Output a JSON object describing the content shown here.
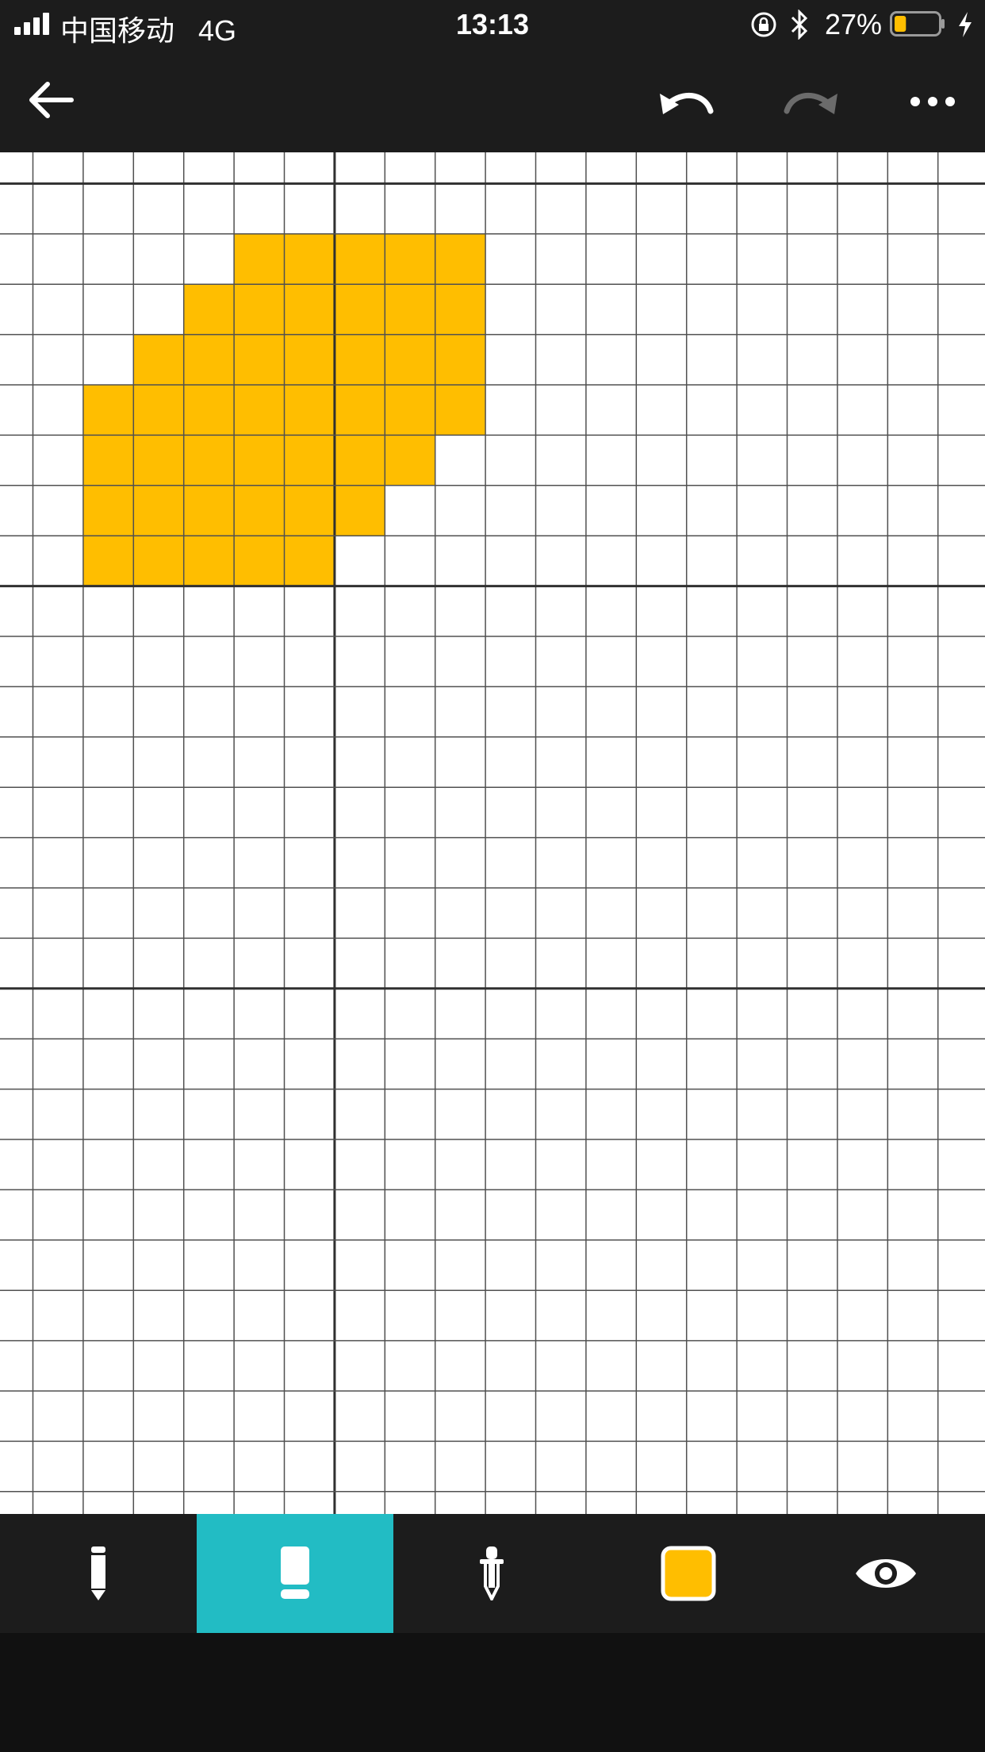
{
  "status_bar": {
    "carrier": "中国移动   4G",
    "time": "13:13",
    "battery": "27%",
    "battery_level": 0.27
  },
  "toolbar": {
    "back_icon": "arrow-left-icon",
    "undo_icon": "undo-icon",
    "redo_icon": "redo-icon",
    "more_icon": "more-horizontal-icon",
    "redo_enabled": false
  },
  "canvas": {
    "fill_color": "#ffbe00",
    "grid_color": "#505050",
    "major_line_color": "#303030",
    "columns": 14,
    "rows": 20,
    "filled_cells": [
      [
        2,
        5
      ],
      [
        2,
        6
      ],
      [
        2,
        7
      ],
      [
        2,
        8
      ],
      [
        2,
        9
      ],
      [
        3,
        4
      ],
      [
        3,
        5
      ],
      [
        3,
        6
      ],
      [
        3,
        7
      ],
      [
        3,
        8
      ],
      [
        3,
        9
      ],
      [
        4,
        3
      ],
      [
        4,
        4
      ],
      [
        4,
        5
      ],
      [
        4,
        6
      ],
      [
        4,
        7
      ],
      [
        4,
        8
      ],
      [
        4,
        9
      ],
      [
        5,
        2
      ],
      [
        5,
        3
      ],
      [
        5,
        4
      ],
      [
        5,
        5
      ],
      [
        5,
        6
      ],
      [
        5,
        7
      ],
      [
        5,
        8
      ],
      [
        5,
        9
      ],
      [
        6,
        2
      ],
      [
        6,
        3
      ],
      [
        6,
        4
      ],
      [
        6,
        5
      ],
      [
        6,
        6
      ],
      [
        6,
        7
      ],
      [
        6,
        8
      ],
      [
        7,
        2
      ],
      [
        7,
        3
      ],
      [
        7,
        4
      ],
      [
        7,
        5
      ],
      [
        7,
        6
      ],
      [
        7,
        7
      ],
      [
        8,
        2
      ],
      [
        8,
        3
      ],
      [
        8,
        4
      ],
      [
        8,
        5
      ],
      [
        8,
        6
      ]
    ]
  },
  "tools": [
    {
      "id": "pencil",
      "icon": "pencil-icon",
      "active": false
    },
    {
      "id": "eraser",
      "icon": "eraser-icon",
      "active": true
    },
    {
      "id": "eyedropper",
      "icon": "eyedropper-icon",
      "active": false
    },
    {
      "id": "color",
      "icon": "color-swatch-icon",
      "active": false,
      "color": "#ffbe00"
    },
    {
      "id": "preview",
      "icon": "eye-icon",
      "active": false
    }
  ],
  "colors": {
    "accent": "#22bcc4",
    "bar_background": "#1c1c1c",
    "icon_color": "#ffffff"
  }
}
